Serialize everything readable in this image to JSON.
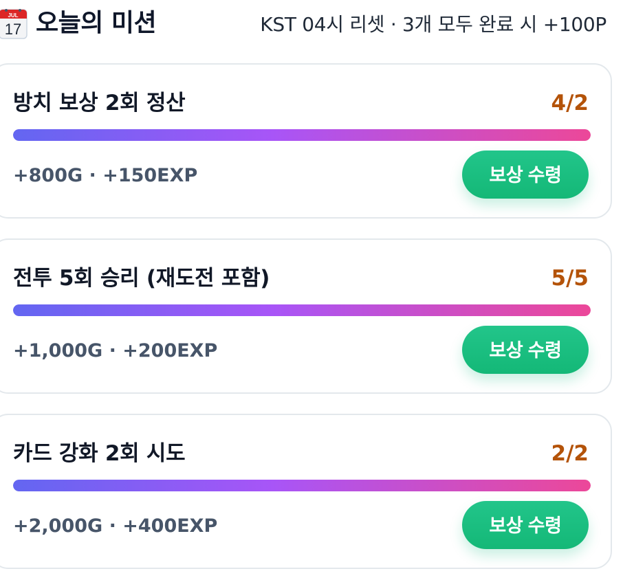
{
  "header": {
    "icon": "calendar-icon",
    "calendar_month": "JUL",
    "calendar_day": "17",
    "title": "오늘의 미션",
    "subtitle": "KST 04시 리셋 · 3개 모두 완료 시 +100P"
  },
  "missions": [
    {
      "title": "방치 보상 2회 정산",
      "progress_text": "4/2",
      "progress_fraction": 1.0,
      "reward": "+800G · +150EXP",
      "button_label": "보상 수령"
    },
    {
      "title": "전투 5회 승리 (재도전 포함)",
      "progress_text": "5/5",
      "progress_fraction": 1.0,
      "reward": "+1,000G · +200EXP",
      "button_label": "보상 수령"
    },
    {
      "title": "카드 강화 2회 시도",
      "progress_text": "2/2",
      "progress_fraction": 1.0,
      "reward": "+2,000G · +400EXP",
      "button_label": "보상 수령"
    }
  ],
  "colors": {
    "progress_text": "#b45309",
    "button": "#1dbf80",
    "progress_gradient_start": "#6366f1",
    "progress_gradient_mid": "#a855f7",
    "progress_gradient_end": "#ec4899"
  }
}
